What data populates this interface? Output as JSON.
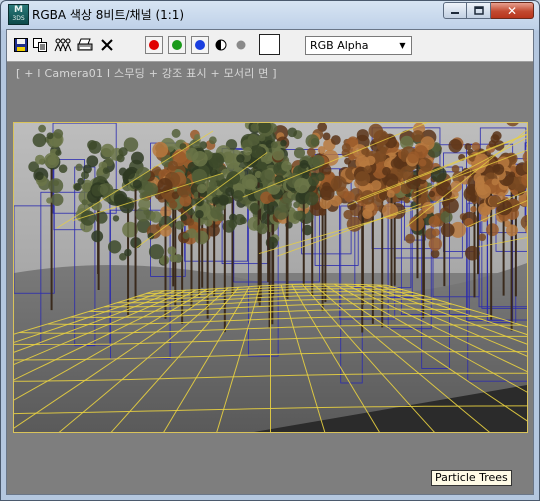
{
  "window": {
    "title": "RGBA 색상 8비트/채널 (1:1)",
    "app_icon_letter": "M",
    "app_icon_sub": "3DS",
    "close_glyph": "✕"
  },
  "toolbar": {
    "icons": [
      "save-icon",
      "copy-icon",
      "clone-icon",
      "print-icon",
      "clear-icon"
    ],
    "channel_colors": {
      "red": "#e00000",
      "green": "#1a9a1a",
      "blue": "#1a3fe0"
    },
    "channel_select": {
      "value": "RGB Alpha"
    }
  },
  "viewport": {
    "label": "[ + I Camera01 I 스무딩 + 강조 표시 + 모서리 면 ]"
  },
  "render": {
    "sky_color": "#b9b9b9",
    "ground_color": "#6a6a6a",
    "wire_color": "#e8d040",
    "frame_color": "#2a2ab0"
  },
  "footer": {
    "badge_label": "Particle Trees"
  }
}
